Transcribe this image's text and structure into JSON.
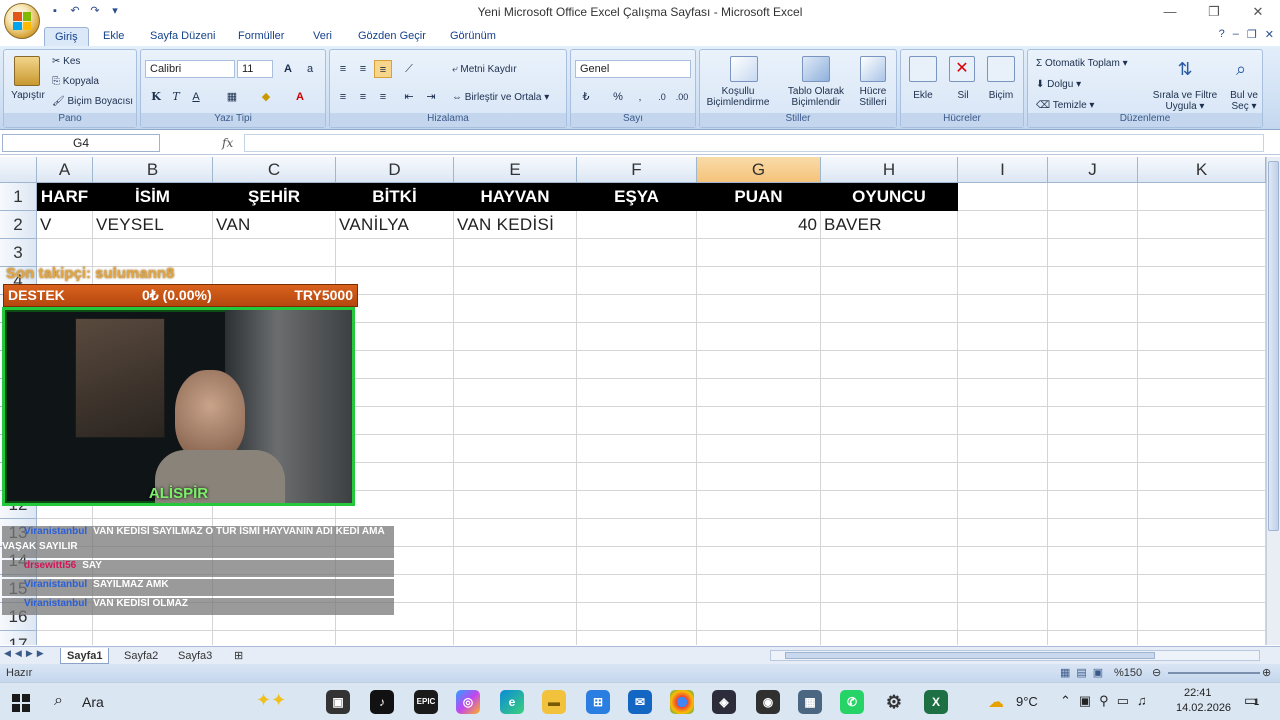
{
  "window": {
    "title": "Yeni Microsoft Office Excel Çalışma Sayfası - Microsoft Excel",
    "controls": [
      "—",
      "❐",
      "✕"
    ]
  },
  "ribbon_tabs": [
    "Giriş",
    "Ekle",
    "Sayfa Düzeni",
    "Formüller",
    "Veri",
    "Gözden Geçir",
    "Görünüm"
  ],
  "ribbon": {
    "pano": {
      "label": "Pano",
      "paste": "Yapıştır",
      "cut": "Kes",
      "copy": "Kopyala",
      "format_painter": "Biçim Boyacısı"
    },
    "font": {
      "label": "Yazı Tipi",
      "font_name": "Calibri",
      "font_size": "11"
    },
    "alignment": {
      "label": "Hizalama",
      "wrap": "Metni Kaydır",
      "merge": "Birleştir ve Ortala"
    },
    "number": {
      "label": "Sayı",
      "format": "Genel"
    },
    "styles": {
      "label": "Stiller",
      "cond1": "Koşullu",
      "cond2": "Biçimlendirme",
      "table1": "Tablo Olarak",
      "table2": "Biçimlendir",
      "cell1": "Hücre",
      "cell2": "Stilleri"
    },
    "cells": {
      "label": "Hücreler",
      "insert": "Ekle",
      "delete": "Sil",
      "format": "Biçim"
    },
    "editing": {
      "label": "Düzenleme",
      "autosum": "Otomatik Toplam",
      "fill": "Dolgu",
      "clear": "Temizle",
      "sort1": "Sırala ve Filtre",
      "sort2": "Uygula",
      "find1": "Bul ve",
      "find2": "Seç"
    }
  },
  "formula_bar": {
    "name_box": "G4",
    "fx": "fx",
    "value": ""
  },
  "columns": [
    "A",
    "B",
    "C",
    "D",
    "E",
    "F",
    "G",
    "H",
    "I",
    "J",
    "K"
  ],
  "rows": [
    "1",
    "2",
    "3",
    "4",
    "5",
    "6",
    "7",
    "8",
    "9",
    "10",
    "11",
    "12",
    "13",
    "14",
    "15",
    "16",
    "17"
  ],
  "row1": [
    "HARF",
    "İSİM",
    "ŞEHİR",
    "BİTKİ",
    "HAYVAN",
    "EŞYA",
    "PUAN",
    "OYUNCU"
  ],
  "row2": [
    "V",
    "VEYSEL",
    "VAN",
    "VANİLYA",
    "VAN KEDİSİ",
    "",
    "40",
    "BAVER"
  ],
  "sheet_tabs": [
    "Sayfa1",
    "Sayfa2",
    "Sayfa3"
  ],
  "status": {
    "ready": "Hazır",
    "zoom": "%150"
  },
  "stream": {
    "last_follower": "Son takipçi: sulumann8",
    "donate_label": "DESTEK",
    "donate_amount": "0₺ (0.00%)",
    "donate_goal": "TRY5000",
    "cam_name": "ALİSPİR",
    "chat": [
      {
        "user": "Viranistanbul",
        "msg": "VAN KEDİSİ SAYILMAZ O TÜR İSMİ HAYVANIN ADI KEDİ AMA",
        "msg2": "VAŞAK SAYILIR"
      },
      {
        "user": "drsewitti56",
        "msg": "SAY"
      },
      {
        "user": "Viranistanbul",
        "msg": "SAYILMAZ AMK"
      },
      {
        "user": "Viranistanbul",
        "msg": "VAN KEDİSİ OLMAZ"
      }
    ]
  },
  "taskbar": {
    "search": "Ara",
    "weather": "9°C",
    "time": "22:41",
    "date": "14.02.2026",
    "notif": "1"
  }
}
